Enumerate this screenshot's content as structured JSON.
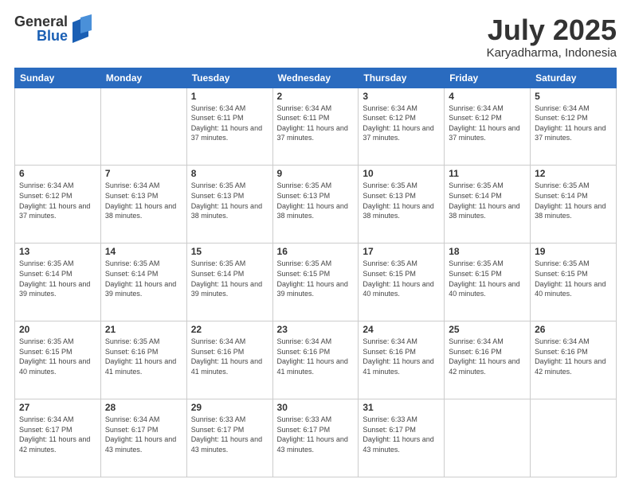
{
  "header": {
    "logo_general": "General",
    "logo_blue": "Blue",
    "month_title": "July 2025",
    "location": "Karyadharma, Indonesia"
  },
  "days_of_week": [
    "Sunday",
    "Monday",
    "Tuesday",
    "Wednesday",
    "Thursday",
    "Friday",
    "Saturday"
  ],
  "weeks": [
    [
      {
        "day": "",
        "sunrise": "",
        "sunset": "",
        "daylight": ""
      },
      {
        "day": "",
        "sunrise": "",
        "sunset": "",
        "daylight": ""
      },
      {
        "day": "1",
        "sunrise": "Sunrise: 6:34 AM",
        "sunset": "Sunset: 6:11 PM",
        "daylight": "Daylight: 11 hours and 37 minutes."
      },
      {
        "day": "2",
        "sunrise": "Sunrise: 6:34 AM",
        "sunset": "Sunset: 6:11 PM",
        "daylight": "Daylight: 11 hours and 37 minutes."
      },
      {
        "day": "3",
        "sunrise": "Sunrise: 6:34 AM",
        "sunset": "Sunset: 6:12 PM",
        "daylight": "Daylight: 11 hours and 37 minutes."
      },
      {
        "day": "4",
        "sunrise": "Sunrise: 6:34 AM",
        "sunset": "Sunset: 6:12 PM",
        "daylight": "Daylight: 11 hours and 37 minutes."
      },
      {
        "day": "5",
        "sunrise": "Sunrise: 6:34 AM",
        "sunset": "Sunset: 6:12 PM",
        "daylight": "Daylight: 11 hours and 37 minutes."
      }
    ],
    [
      {
        "day": "6",
        "sunrise": "Sunrise: 6:34 AM",
        "sunset": "Sunset: 6:12 PM",
        "daylight": "Daylight: 11 hours and 37 minutes."
      },
      {
        "day": "7",
        "sunrise": "Sunrise: 6:34 AM",
        "sunset": "Sunset: 6:13 PM",
        "daylight": "Daylight: 11 hours and 38 minutes."
      },
      {
        "day": "8",
        "sunrise": "Sunrise: 6:35 AM",
        "sunset": "Sunset: 6:13 PM",
        "daylight": "Daylight: 11 hours and 38 minutes."
      },
      {
        "day": "9",
        "sunrise": "Sunrise: 6:35 AM",
        "sunset": "Sunset: 6:13 PM",
        "daylight": "Daylight: 11 hours and 38 minutes."
      },
      {
        "day": "10",
        "sunrise": "Sunrise: 6:35 AM",
        "sunset": "Sunset: 6:13 PM",
        "daylight": "Daylight: 11 hours and 38 minutes."
      },
      {
        "day": "11",
        "sunrise": "Sunrise: 6:35 AM",
        "sunset": "Sunset: 6:14 PM",
        "daylight": "Daylight: 11 hours and 38 minutes."
      },
      {
        "day": "12",
        "sunrise": "Sunrise: 6:35 AM",
        "sunset": "Sunset: 6:14 PM",
        "daylight": "Daylight: 11 hours and 38 minutes."
      }
    ],
    [
      {
        "day": "13",
        "sunrise": "Sunrise: 6:35 AM",
        "sunset": "Sunset: 6:14 PM",
        "daylight": "Daylight: 11 hours and 39 minutes."
      },
      {
        "day": "14",
        "sunrise": "Sunrise: 6:35 AM",
        "sunset": "Sunset: 6:14 PM",
        "daylight": "Daylight: 11 hours and 39 minutes."
      },
      {
        "day": "15",
        "sunrise": "Sunrise: 6:35 AM",
        "sunset": "Sunset: 6:14 PM",
        "daylight": "Daylight: 11 hours and 39 minutes."
      },
      {
        "day": "16",
        "sunrise": "Sunrise: 6:35 AM",
        "sunset": "Sunset: 6:15 PM",
        "daylight": "Daylight: 11 hours and 39 minutes."
      },
      {
        "day": "17",
        "sunrise": "Sunrise: 6:35 AM",
        "sunset": "Sunset: 6:15 PM",
        "daylight": "Daylight: 11 hours and 40 minutes."
      },
      {
        "day": "18",
        "sunrise": "Sunrise: 6:35 AM",
        "sunset": "Sunset: 6:15 PM",
        "daylight": "Daylight: 11 hours and 40 minutes."
      },
      {
        "day": "19",
        "sunrise": "Sunrise: 6:35 AM",
        "sunset": "Sunset: 6:15 PM",
        "daylight": "Daylight: 11 hours and 40 minutes."
      }
    ],
    [
      {
        "day": "20",
        "sunrise": "Sunrise: 6:35 AM",
        "sunset": "Sunset: 6:15 PM",
        "daylight": "Daylight: 11 hours and 40 minutes."
      },
      {
        "day": "21",
        "sunrise": "Sunrise: 6:35 AM",
        "sunset": "Sunset: 6:16 PM",
        "daylight": "Daylight: 11 hours and 41 minutes."
      },
      {
        "day": "22",
        "sunrise": "Sunrise: 6:34 AM",
        "sunset": "Sunset: 6:16 PM",
        "daylight": "Daylight: 11 hours and 41 minutes."
      },
      {
        "day": "23",
        "sunrise": "Sunrise: 6:34 AM",
        "sunset": "Sunset: 6:16 PM",
        "daylight": "Daylight: 11 hours and 41 minutes."
      },
      {
        "day": "24",
        "sunrise": "Sunrise: 6:34 AM",
        "sunset": "Sunset: 6:16 PM",
        "daylight": "Daylight: 11 hours and 41 minutes."
      },
      {
        "day": "25",
        "sunrise": "Sunrise: 6:34 AM",
        "sunset": "Sunset: 6:16 PM",
        "daylight": "Daylight: 11 hours and 42 minutes."
      },
      {
        "day": "26",
        "sunrise": "Sunrise: 6:34 AM",
        "sunset": "Sunset: 6:16 PM",
        "daylight": "Daylight: 11 hours and 42 minutes."
      }
    ],
    [
      {
        "day": "27",
        "sunrise": "Sunrise: 6:34 AM",
        "sunset": "Sunset: 6:17 PM",
        "daylight": "Daylight: 11 hours and 42 minutes."
      },
      {
        "day": "28",
        "sunrise": "Sunrise: 6:34 AM",
        "sunset": "Sunset: 6:17 PM",
        "daylight": "Daylight: 11 hours and 43 minutes."
      },
      {
        "day": "29",
        "sunrise": "Sunrise: 6:33 AM",
        "sunset": "Sunset: 6:17 PM",
        "daylight": "Daylight: 11 hours and 43 minutes."
      },
      {
        "day": "30",
        "sunrise": "Sunrise: 6:33 AM",
        "sunset": "Sunset: 6:17 PM",
        "daylight": "Daylight: 11 hours and 43 minutes."
      },
      {
        "day": "31",
        "sunrise": "Sunrise: 6:33 AM",
        "sunset": "Sunset: 6:17 PM",
        "daylight": "Daylight: 11 hours and 43 minutes."
      },
      {
        "day": "",
        "sunrise": "",
        "sunset": "",
        "daylight": ""
      },
      {
        "day": "",
        "sunrise": "",
        "sunset": "",
        "daylight": ""
      }
    ]
  ]
}
